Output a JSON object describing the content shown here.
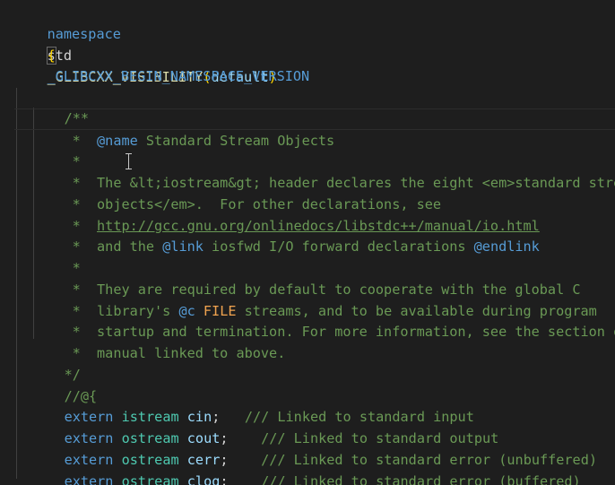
{
  "code": {
    "line1": {
      "kw_namespace": "namespace",
      "ns_name": "std",
      "macro": "_GLIBCXX_VISIBILITY",
      "open_paren": "(",
      "arg": "default",
      "close_paren": ")"
    },
    "line2": {
      "brace": "{"
    },
    "line3": {
      "macro": "_GLIBCXX_BEGIN_NAMESPACE_VERSION"
    },
    "comment": {
      "open": "/**",
      "star": "*",
      "name_tag": "@name",
      "name_text": " Standard Stream Objects",
      "p1_l1": "The &lt;iostream&gt; header declares the eight <em>standard stre",
      "p1_l2": "objects</em>.  For other declarations, see",
      "p1_l3_link": "http://gcc.gnu.org/onlinedocs/libstdc++/manual/io.html",
      "p1_l4_a": "and the ",
      "link_tag": "@link",
      "p1_l4_b": " iosfwd I/O forward declarations ",
      "endlink_tag": "@endlink",
      "p2_l1": "They are required by default to cooperate with the global C",
      "p2_l2_a": "library's ",
      "c_tag": "@c",
      "file_word": " FILE",
      "p2_l2_b": " streams, and to be available during program",
      "p2_l3": "startup and termination. For more information, see the section o",
      "p2_l4": "manual linked to above.",
      "close": "*/",
      "group_open": "//@{"
    },
    "decls": [
      {
        "kw": "extern",
        "type": "istream",
        "name": "cin",
        "punct": ";",
        "gap": "   ",
        "comment": "/// Linked to standard input"
      },
      {
        "kw": "extern",
        "type": "ostream",
        "name": "cout",
        "punct": ";",
        "gap": "    ",
        "comment": "/// Linked to standard output"
      },
      {
        "kw": "extern",
        "type": "ostream",
        "name": "cerr",
        "punct": ";",
        "gap": "    ",
        "comment": "/// Linked to standard error (unbuffered)"
      },
      {
        "kw": "extern",
        "type": "ostream",
        "name": "clog",
        "punct": ";",
        "gap": "    ",
        "comment": "/// Linked to standard error (buffered)"
      }
    ]
  },
  "colors": {
    "background": "#1e1e1e",
    "keyword": "#569cd6",
    "type": "#4ec9b0",
    "variable": "#9cdcfe",
    "comment": "#6a9955",
    "bracket": "#ffd700",
    "doc_file": "#f0a34f"
  }
}
